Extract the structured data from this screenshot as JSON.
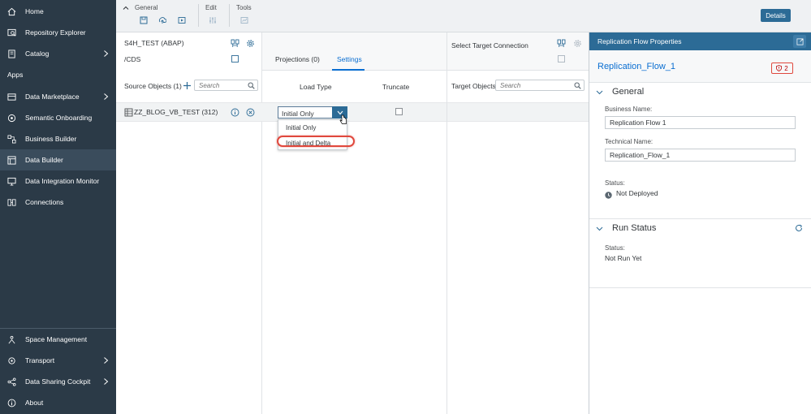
{
  "sidebar": {
    "items_top": [
      {
        "label": "Home",
        "icon": "home-icon"
      },
      {
        "label": "Repository Explorer",
        "icon": "repository-icon"
      },
      {
        "label": "Catalog",
        "icon": "catalog-icon",
        "chevron": true
      }
    ],
    "section_apps": "Apps",
    "items_apps": [
      {
        "label": "Data Marketplace",
        "icon": "marketplace-icon",
        "chevron": true
      },
      {
        "label": "Semantic Onboarding",
        "icon": "onboarding-icon"
      },
      {
        "label": "Business Builder",
        "icon": "business-builder-icon"
      },
      {
        "label": "Data Builder",
        "icon": "data-builder-icon",
        "active": true
      },
      {
        "label": "Data Integration Monitor",
        "icon": "monitor-icon"
      },
      {
        "label": "Connections",
        "icon": "connections-icon"
      }
    ],
    "items_bottom": [
      {
        "label": "Space Management",
        "icon": "space-icon"
      },
      {
        "label": "Transport",
        "icon": "transport-icon",
        "chevron": true
      },
      {
        "label": "Data Sharing Cockpit",
        "icon": "share-icon",
        "chevron": true
      },
      {
        "label": "About",
        "icon": "info-icon"
      }
    ]
  },
  "toolbar": {
    "general_label": "General",
    "edit_label": "Edit",
    "tools_label": "Tools",
    "details_label": "Details"
  },
  "source": {
    "connection_name": "S4H_TEST (ABAP)",
    "container_path": "/CDS",
    "objects_label": "Source Objects (1)",
    "search_placeholder": "Search",
    "object_name": "ZZ_BLOG_VB_TEST (312)"
  },
  "middle": {
    "tab_projections": "Projections (0)",
    "tab_settings": "Settings",
    "col_load_type": "Load Type",
    "col_truncate": "Truncate",
    "load_type_value": "Initial Only",
    "options": [
      "Initial Only",
      "Initial and Delta"
    ]
  },
  "target": {
    "select_label": "Select Target Connection",
    "objects_label": "Target Objects",
    "search_placeholder": "Search"
  },
  "properties": {
    "header": "Replication Flow Properties",
    "flow_name": "Replication_Flow_1",
    "error_count": "2",
    "general_title": "General",
    "business_name_label": "Business Name:",
    "business_name_value": "Replication Flow 1",
    "technical_name_label": "Technical Name:",
    "technical_name_value": "Replication_Flow_1",
    "status_label": "Status:",
    "status_value": "Not Deployed",
    "run_status_title": "Run Status",
    "run_status_label": "Status:",
    "run_status_value": "Not Run Yet"
  },
  "colors": {
    "sidebar_bg": "#2b3a47",
    "accent": "#2c6b96",
    "link": "#0a6ed1",
    "error": "#e0483d"
  }
}
